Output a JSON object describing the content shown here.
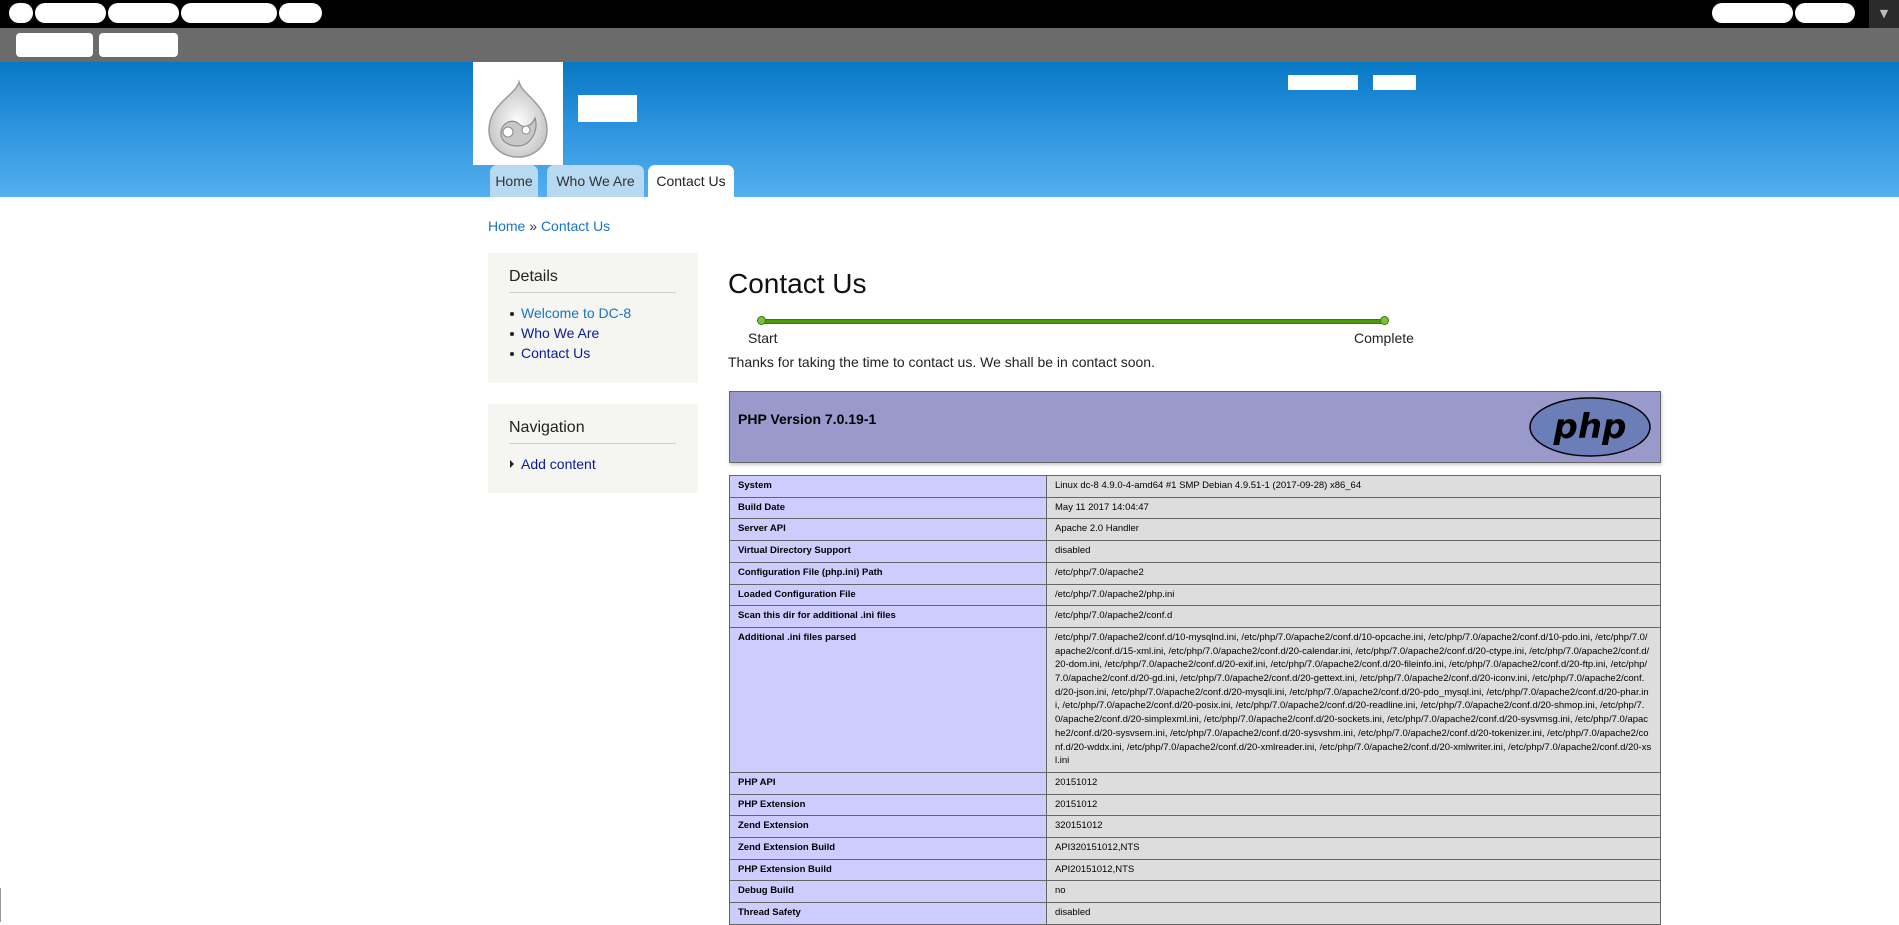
{
  "header": {
    "tabs": [
      {
        "label": "Home"
      },
      {
        "label": "Who We Are"
      },
      {
        "label": "Contact Us"
      }
    ]
  },
  "breadcrumb": {
    "home": "Home",
    "separator": "»",
    "current": "Contact Us"
  },
  "sidebar": {
    "details": {
      "title": "Details",
      "items": [
        {
          "label": "Welcome to DC-8"
        },
        {
          "label": "Who We Are"
        },
        {
          "label": "Contact Us"
        }
      ]
    },
    "navigation": {
      "title": "Navigation",
      "items": [
        {
          "label": "Add content"
        }
      ]
    }
  },
  "main": {
    "title": "Contact Us",
    "progress": {
      "start": "Start",
      "end": "Complete",
      "percent": 100
    },
    "message": "Thanks for taking the time to contact us. We shall be in contact soon."
  },
  "phpinfo": {
    "version": "PHP Version 7.0.19-1",
    "logo_text": "php",
    "rows": [
      {
        "key": "System",
        "value": "Linux dc-8 4.9.0-4-amd64 #1 SMP Debian 4.9.51-1 (2017-09-28) x86_64"
      },
      {
        "key": "Build Date",
        "value": "May 11 2017 14:04:47"
      },
      {
        "key": "Server API",
        "value": "Apache 2.0 Handler"
      },
      {
        "key": "Virtual Directory Support",
        "value": "disabled"
      },
      {
        "key": "Configuration File (php.ini) Path",
        "value": "/etc/php/7.0/apache2"
      },
      {
        "key": "Loaded Configuration File",
        "value": "/etc/php/7.0/apache2/php.ini"
      },
      {
        "key": "Scan this dir for additional .ini files",
        "value": "/etc/php/7.0/apache2/conf.d"
      },
      {
        "key": "Additional .ini files parsed",
        "value": "/etc/php/7.0/apache2/conf.d/10-mysqlnd.ini, /etc/php/7.0/apache2/conf.d/10-opcache.ini, /etc/php/7.0/apache2/conf.d/10-pdo.ini, /etc/php/7.0/apache2/conf.d/15-xml.ini, /etc/php/7.0/apache2/conf.d/20-calendar.ini, /etc/php/7.0/apache2/conf.d/20-ctype.ini, /etc/php/7.0/apache2/conf.d/20-dom.ini, /etc/php/7.0/apache2/conf.d/20-exif.ini, /etc/php/7.0/apache2/conf.d/20-fileinfo.ini, /etc/php/7.0/apache2/conf.d/20-ftp.ini, /etc/php/7.0/apache2/conf.d/20-gd.ini, /etc/php/7.0/apache2/conf.d/20-gettext.ini, /etc/php/7.0/apache2/conf.d/20-iconv.ini, /etc/php/7.0/apache2/conf.d/20-json.ini, /etc/php/7.0/apache2/conf.d/20-mysqli.ini, /etc/php/7.0/apache2/conf.d/20-pdo_mysql.ini, /etc/php/7.0/apache2/conf.d/20-phar.ini, /etc/php/7.0/apache2/conf.d/20-posix.ini, /etc/php/7.0/apache2/conf.d/20-readline.ini, /etc/php/7.0/apache2/conf.d/20-shmop.ini, /etc/php/7.0/apache2/conf.d/20-simplexml.ini, /etc/php/7.0/apache2/conf.d/20-sockets.ini, /etc/php/7.0/apache2/conf.d/20-sysvmsg.ini, /etc/php/7.0/apache2/conf.d/20-sysvsem.ini, /etc/php/7.0/apache2/conf.d/20-sysvshm.ini, /etc/php/7.0/apache2/conf.d/20-tokenizer.ini, /etc/php/7.0/apache2/conf.d/20-wddx.ini, /etc/php/7.0/apache2/conf.d/20-xmlreader.ini, /etc/php/7.0/apache2/conf.d/20-xmlwriter.ini, /etc/php/7.0/apache2/conf.d/20-xsl.ini"
      },
      {
        "key": "PHP API",
        "value": "20151012"
      },
      {
        "key": "PHP Extension",
        "value": "20151012"
      },
      {
        "key": "Zend Extension",
        "value": "320151012"
      },
      {
        "key": "Zend Extension Build",
        "value": "API320151012,NTS"
      },
      {
        "key": "PHP Extension Build",
        "value": "API20151012,NTS"
      },
      {
        "key": "Debug Build",
        "value": "no"
      },
      {
        "key": "Thread Safety",
        "value": "disabled"
      }
    ]
  },
  "colors": {
    "header_gradient_top": "#0778c5",
    "header_gradient_bottom": "#54b0ee",
    "link_blue": "#1a74c6",
    "link_navy": "#0b1a97",
    "php_header": "#9999cc",
    "php_key_cell": "#ccccff",
    "php_value_cell": "#dddddd",
    "progress_green": "#4e9a06"
  },
  "icons": {
    "logo": "drupal-drop-logo-icon",
    "php_logo": "php-logo-icon",
    "toolbar_toggle": "chevron-down-icon"
  }
}
